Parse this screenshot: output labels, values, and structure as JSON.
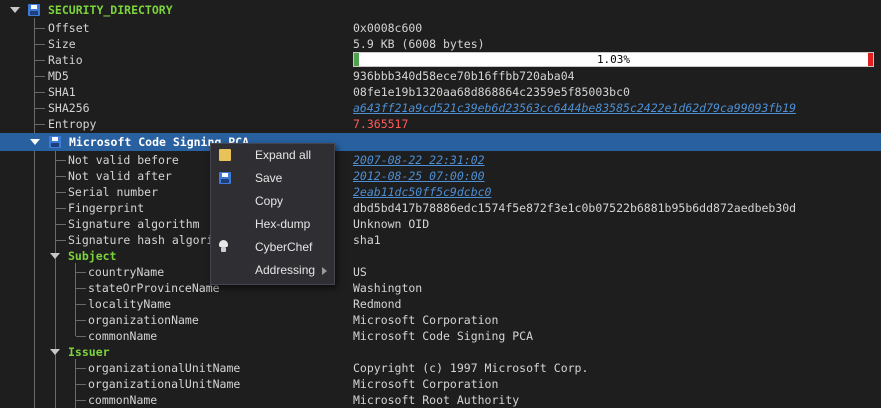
{
  "root": {
    "label": "SECURITY_DIRECTORY"
  },
  "fields": [
    {
      "key": "Offset",
      "value": "0x0008c600"
    },
    {
      "key": "Size",
      "value": "5.9 KB (6008 bytes)"
    },
    {
      "key": "Ratio",
      "value": "1.03%",
      "fraction": 0.0103
    },
    {
      "key": "MD5",
      "value": "936bbb340d58ece70b16ffbb720aba04"
    },
    {
      "key": "SHA1",
      "value": "08fe1e19b1320aa68d868864c2359e5f85003bc0"
    },
    {
      "key": "SHA256",
      "value": "a643ff21a9cd521c39eb6d23563cc6444be83585c2422e1d62d79ca99093fb19"
    },
    {
      "key": "Entropy",
      "value": "7.365517"
    }
  ],
  "cert": {
    "label": "Microsoft Code Signing PCA",
    "fields": [
      {
        "key": "Not valid before",
        "value": "2007-08-22 22:31:02"
      },
      {
        "key": "Not valid after",
        "value": "2012-08-25 07:00:00"
      },
      {
        "key": "Serial number",
        "value": "2eab11dc50ff5c9dcbc0"
      },
      {
        "key": "Fingerprint",
        "value": "dbd5bd417b78886edc1574f5e872f3e1c0b07522b6881b95b6dd872aedbeb30d"
      },
      {
        "key": "Signature algorithm",
        "value": "Unknown OID"
      },
      {
        "key": "Signature hash algorithm",
        "value": "sha1"
      }
    ],
    "subject": {
      "label": "Subject",
      "fields": [
        {
          "key": "countryName",
          "value": "US"
        },
        {
          "key": "stateOrProvinceName",
          "value": "Washington"
        },
        {
          "key": "localityName",
          "value": "Redmond"
        },
        {
          "key": "organizationName",
          "value": "Microsoft Corporation"
        },
        {
          "key": "commonName",
          "value": "Microsoft Code Signing PCA"
        }
      ]
    },
    "issuer": {
      "label": "Issuer",
      "fields": [
        {
          "key": "organizationalUnitName",
          "value": "Copyright (c) 1997 Microsoft Corp."
        },
        {
          "key": "organizationalUnitName",
          "value": "Microsoft Corporation"
        },
        {
          "key": "commonName",
          "value": "Microsoft Root Authority"
        }
      ]
    }
  },
  "context_menu": {
    "items": [
      {
        "label": "Expand all",
        "icon": "folder-icon"
      },
      {
        "label": "Save",
        "icon": "disk-icon"
      },
      {
        "label": "Copy",
        "icon": ""
      },
      {
        "label": "Hex-dump",
        "icon": ""
      },
      {
        "label": "CyberChef",
        "icon": "chef-hat-icon"
      },
      {
        "label": "Addressing",
        "icon": "",
        "submenu": true
      }
    ]
  },
  "colors": {
    "header": "#7cd33c",
    "selection": "#2860a0",
    "link": "#4d8fd4",
    "entropy": "#ff5a5a",
    "ratio_fill": "#4fa04f"
  }
}
